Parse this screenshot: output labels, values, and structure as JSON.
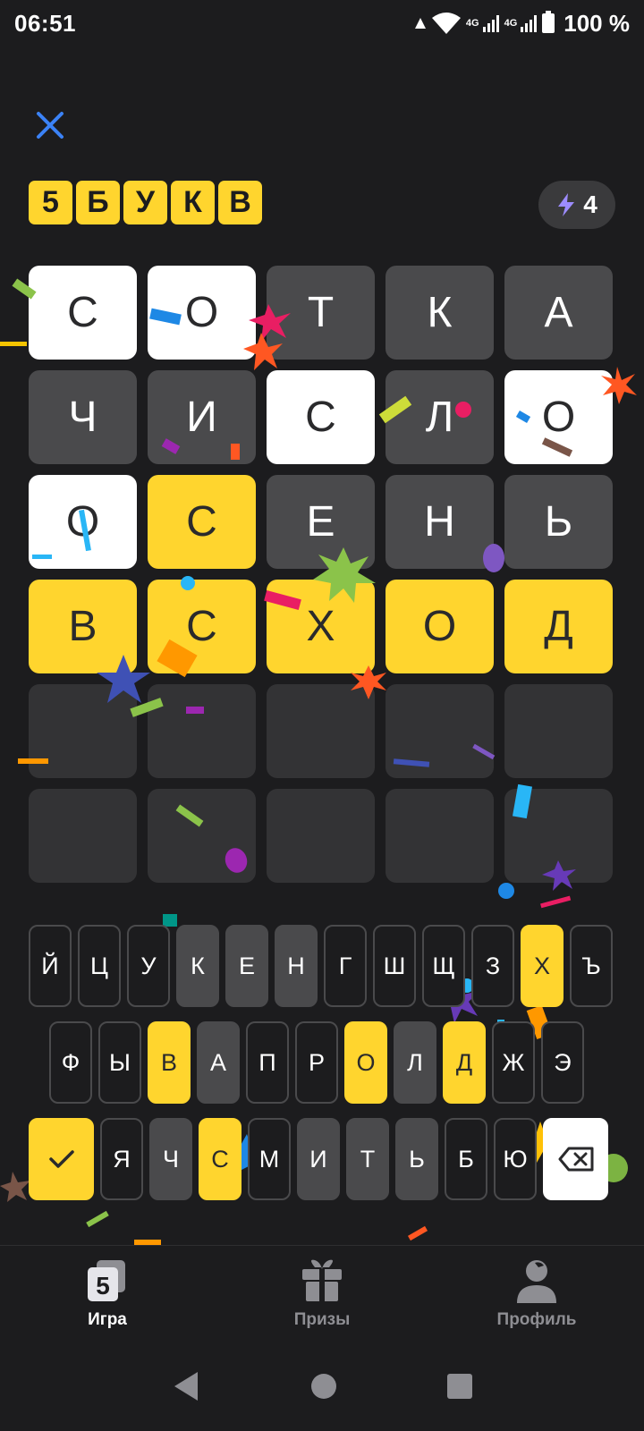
{
  "status_bar": {
    "time": "06:51",
    "net1": "4G",
    "net2": "4G",
    "battery": "100 %"
  },
  "header": {
    "close_icon": "close-icon",
    "logo_letters": [
      "5",
      "Б",
      "У",
      "К",
      "В"
    ],
    "energy_icon": "lightning-icon",
    "energy_count": "4"
  },
  "board": {
    "rows": [
      [
        {
          "letter": "С",
          "state": "present"
        },
        {
          "letter": "О",
          "state": "present"
        },
        {
          "letter": "Т",
          "state": "absent"
        },
        {
          "letter": "К",
          "state": "absent"
        },
        {
          "letter": "А",
          "state": "absent"
        }
      ],
      [
        {
          "letter": "Ч",
          "state": "absent"
        },
        {
          "letter": "И",
          "state": "absent"
        },
        {
          "letter": "С",
          "state": "present"
        },
        {
          "letter": "Л",
          "state": "absent"
        },
        {
          "letter": "О",
          "state": "present"
        }
      ],
      [
        {
          "letter": "О",
          "state": "present"
        },
        {
          "letter": "С",
          "state": "correct"
        },
        {
          "letter": "Е",
          "state": "absent"
        },
        {
          "letter": "Н",
          "state": "absent"
        },
        {
          "letter": "Ь",
          "state": "absent"
        }
      ],
      [
        {
          "letter": "В",
          "state": "correct"
        },
        {
          "letter": "С",
          "state": "correct"
        },
        {
          "letter": "Х",
          "state": "correct"
        },
        {
          "letter": "О",
          "state": "correct"
        },
        {
          "letter": "Д",
          "state": "correct"
        }
      ],
      [
        {
          "letter": "",
          "state": "empty"
        },
        {
          "letter": "",
          "state": "empty"
        },
        {
          "letter": "",
          "state": "empty"
        },
        {
          "letter": "",
          "state": "empty"
        },
        {
          "letter": "",
          "state": "empty"
        }
      ],
      [
        {
          "letter": "",
          "state": "empty"
        },
        {
          "letter": "",
          "state": "empty"
        },
        {
          "letter": "",
          "state": "empty"
        },
        {
          "letter": "",
          "state": "empty"
        },
        {
          "letter": "",
          "state": "empty"
        }
      ]
    ]
  },
  "keyboard": {
    "row1": [
      {
        "k": "Й",
        "s": "normal"
      },
      {
        "k": "Ц",
        "s": "normal"
      },
      {
        "k": "У",
        "s": "normal"
      },
      {
        "k": "К",
        "s": "absent"
      },
      {
        "k": "Е",
        "s": "absent"
      },
      {
        "k": "Н",
        "s": "absent"
      },
      {
        "k": "Г",
        "s": "normal"
      },
      {
        "k": "Ш",
        "s": "normal"
      },
      {
        "k": "Щ",
        "s": "normal"
      },
      {
        "k": "З",
        "s": "normal"
      },
      {
        "k": "Х",
        "s": "correct"
      },
      {
        "k": "Ъ",
        "s": "normal"
      }
    ],
    "row2": [
      {
        "k": "Ф",
        "s": "normal"
      },
      {
        "k": "Ы",
        "s": "normal"
      },
      {
        "k": "В",
        "s": "correct"
      },
      {
        "k": "А",
        "s": "absent"
      },
      {
        "k": "П",
        "s": "normal"
      },
      {
        "k": "Р",
        "s": "normal"
      },
      {
        "k": "О",
        "s": "correct"
      },
      {
        "k": "Л",
        "s": "absent"
      },
      {
        "k": "Д",
        "s": "correct"
      },
      {
        "k": "Ж",
        "s": "normal"
      },
      {
        "k": "Э",
        "s": "normal"
      }
    ],
    "row3": [
      {
        "k": "Я",
        "s": "normal"
      },
      {
        "k": "Ч",
        "s": "absent"
      },
      {
        "k": "С",
        "s": "correct"
      },
      {
        "k": "М",
        "s": "normal"
      },
      {
        "k": "И",
        "s": "absent"
      },
      {
        "k": "Т",
        "s": "absent"
      },
      {
        "k": "Ь",
        "s": "absent"
      },
      {
        "k": "Б",
        "s": "normal"
      },
      {
        "k": "Ю",
        "s": "normal"
      }
    ],
    "enter_icon": "check-icon",
    "backspace_icon": "backspace-icon"
  },
  "bottom_nav": {
    "items": [
      {
        "label": "Игра",
        "icon": "game-icon",
        "active": true
      },
      {
        "label": "Призы",
        "icon": "gift-icon",
        "active": false
      },
      {
        "label": "Профиль",
        "icon": "profile-icon",
        "active": false
      }
    ]
  },
  "colors": {
    "background": "#1c1c1e",
    "correct": "#ffd52e",
    "present": "#ffffff",
    "absent": "#4a4a4c",
    "empty": "#333335",
    "accent": "#3b82f6"
  }
}
